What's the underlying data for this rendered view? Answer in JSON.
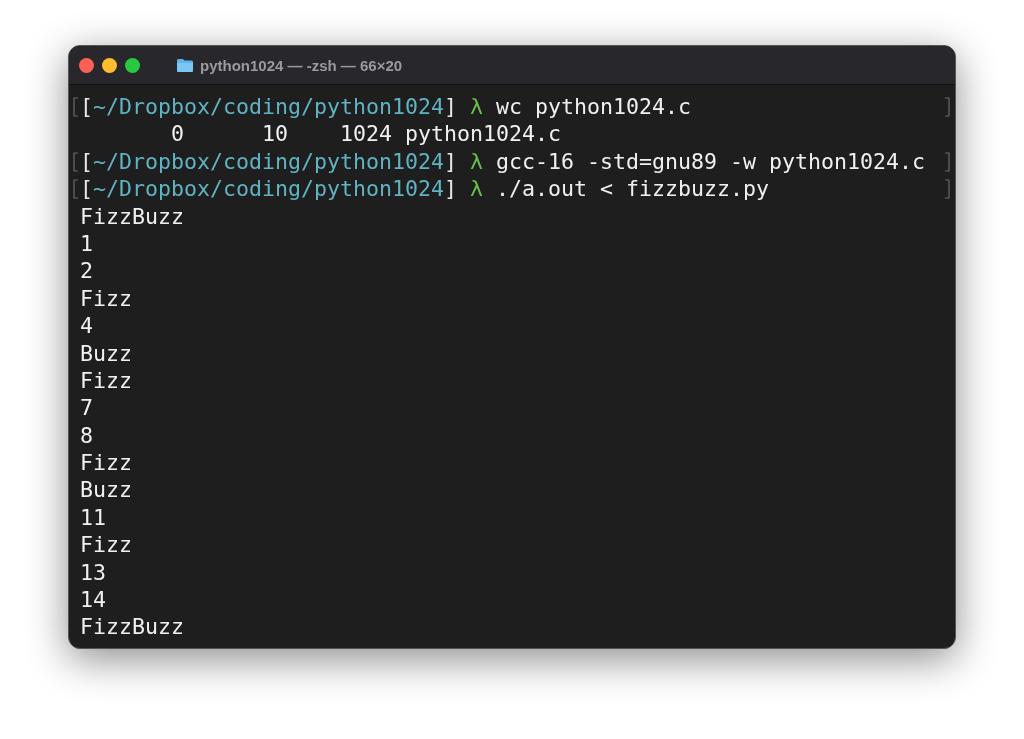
{
  "window": {
    "title": "python1024 — -zsh — 66×20"
  },
  "lines": [
    {
      "kind": "prompt",
      "marked": true,
      "open": "[",
      "path": "~/Dropbox/coding/python1024",
      "close": "]",
      "symbol": "λ",
      "command": "wc python1024.c"
    },
    {
      "kind": "output",
      "marked": false,
      "text": "       0      10    1024 python1024.c"
    },
    {
      "kind": "prompt",
      "marked": true,
      "open": "[",
      "path": "~/Dropbox/coding/python1024",
      "close": "]",
      "symbol": "λ",
      "command": "gcc-16 -std=gnu89 -w python1024.c"
    },
    {
      "kind": "prompt",
      "marked": true,
      "open": "[",
      "path": "~/Dropbox/coding/python1024",
      "close": "]",
      "symbol": "λ",
      "command": "./a.out < fizzbuzz.py"
    },
    {
      "kind": "output",
      "marked": false,
      "text": "FizzBuzz"
    },
    {
      "kind": "output",
      "marked": false,
      "text": "1"
    },
    {
      "kind": "output",
      "marked": false,
      "text": "2"
    },
    {
      "kind": "output",
      "marked": false,
      "text": "Fizz"
    },
    {
      "kind": "output",
      "marked": false,
      "text": "4"
    },
    {
      "kind": "output",
      "marked": false,
      "text": "Buzz"
    },
    {
      "kind": "output",
      "marked": false,
      "text": "Fizz"
    },
    {
      "kind": "output",
      "marked": false,
      "text": "7"
    },
    {
      "kind": "output",
      "marked": false,
      "text": "8"
    },
    {
      "kind": "output",
      "marked": false,
      "text": "Fizz"
    },
    {
      "kind": "output",
      "marked": false,
      "text": "Buzz"
    },
    {
      "kind": "output",
      "marked": false,
      "text": "11"
    },
    {
      "kind": "output",
      "marked": false,
      "text": "Fizz"
    },
    {
      "kind": "output",
      "marked": false,
      "text": "13"
    },
    {
      "kind": "output",
      "marked": false,
      "text": "14"
    },
    {
      "kind": "output",
      "marked": false,
      "text": "FizzBuzz"
    }
  ]
}
